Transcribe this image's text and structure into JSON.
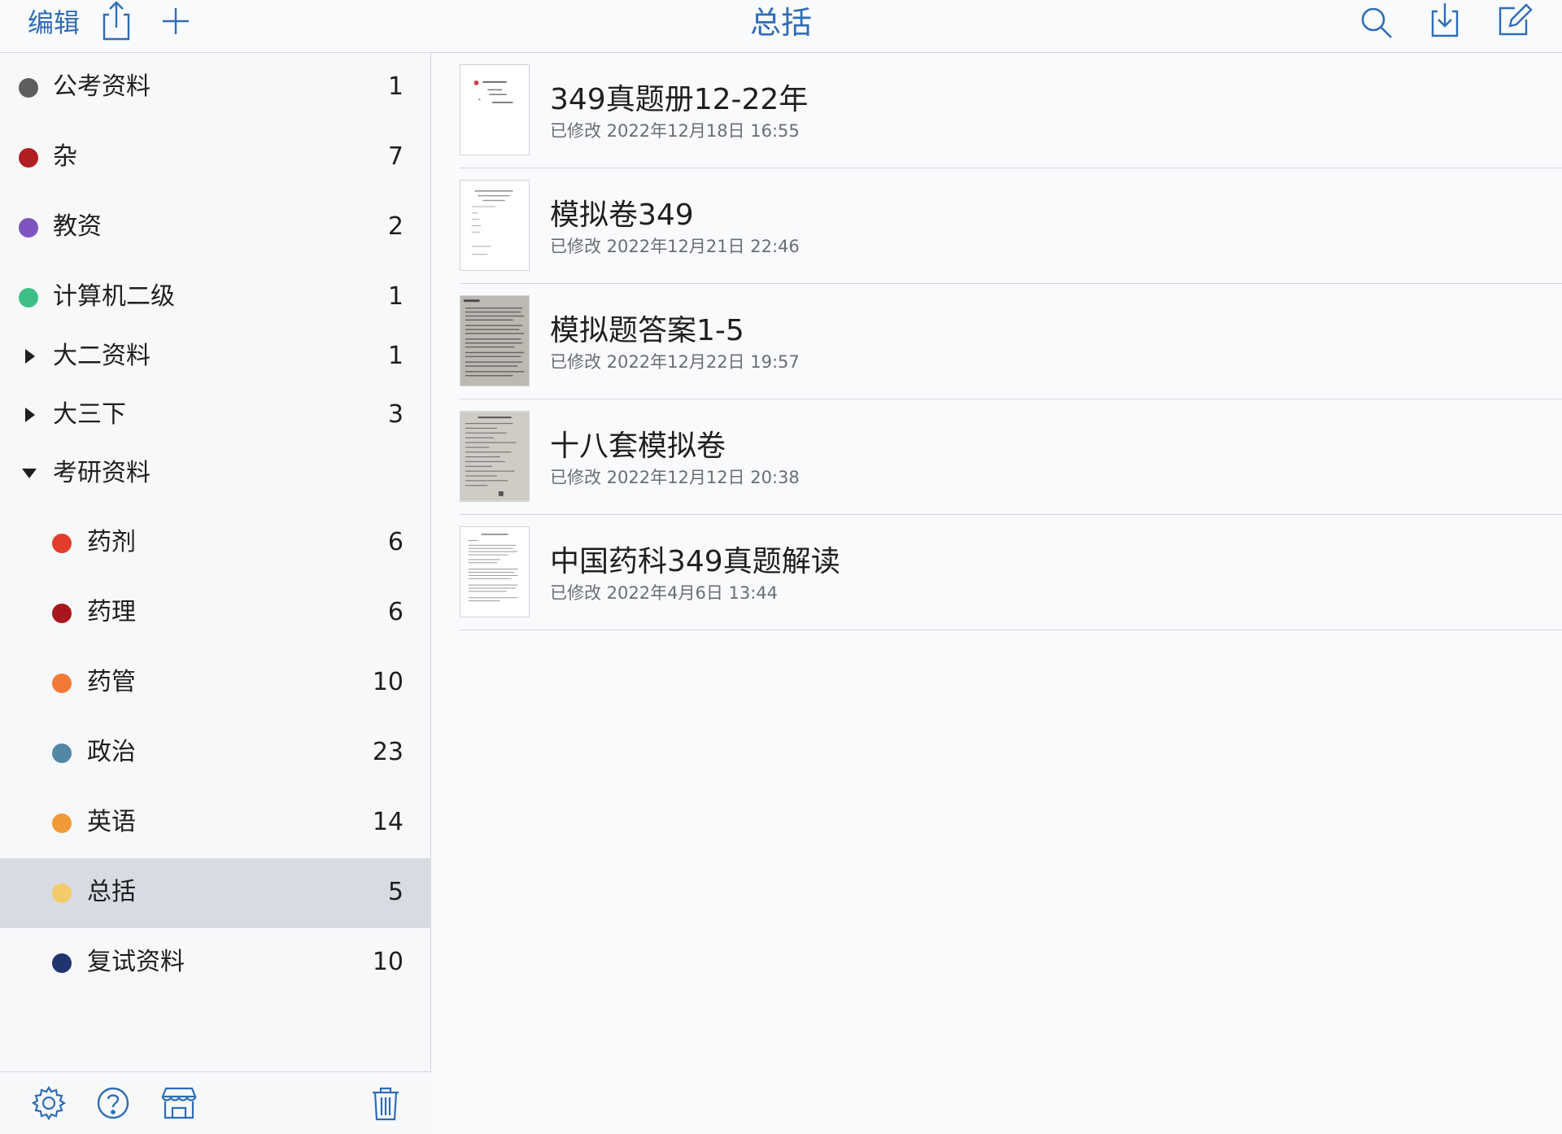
{
  "header": {
    "edit_label": "编辑",
    "title": "总括",
    "icons": [
      "share-icon",
      "plus-icon",
      "search-icon",
      "import-icon",
      "compose-icon"
    ],
    "accent_color": "#2f6db5"
  },
  "sidebar": {
    "items": [
      {
        "label": "公考资料",
        "count": "1",
        "dot_color": "#5d5e60"
      },
      {
        "label": "杂",
        "count": "7",
        "dot_color": "#b01e21"
      },
      {
        "label": "教资",
        "count": "2",
        "dot_color": "#7e55c0"
      },
      {
        "label": "计算机二级",
        "count": "1",
        "dot_color": "#3fbf87"
      },
      {
        "label": "大二资料",
        "count": "1",
        "expander": "collapsed"
      },
      {
        "label": "大三下",
        "count": "3",
        "expander": "collapsed"
      },
      {
        "label": "考研资料",
        "count": "",
        "expander": "expanded"
      },
      {
        "label": "药剂",
        "count": "6",
        "dot_color": "#e33d2c"
      },
      {
        "label": "药理",
        "count": "6",
        "dot_color": "#a8161d"
      },
      {
        "label": "药管",
        "count": "10",
        "dot_color": "#f27a36"
      },
      {
        "label": "政治",
        "count": "23",
        "dot_color": "#5387a6"
      },
      {
        "label": "英语",
        "count": "14",
        "dot_color": "#f09a38"
      },
      {
        "label": "总括",
        "count": "5",
        "dot_color": "#f4cb6a",
        "selected": true
      },
      {
        "label": "复试资料",
        "count": "10",
        "dot_color": "#20356e"
      }
    ],
    "bottom_icons": [
      "gear-icon",
      "help-icon",
      "store-icon",
      "trash-icon"
    ]
  },
  "documents": [
    {
      "title": "349真题册12-22年",
      "modified": "已修改 2022年12月18日 16:55",
      "thumb": "cover"
    },
    {
      "title": "模拟卷349",
      "modified": "已修改 2022年12月21日 22:46",
      "thumb": "sparse"
    },
    {
      "title": "模拟题答案1-5",
      "modified": "已修改 2022年12月22日 19:57",
      "thumb": "scan-dark"
    },
    {
      "title": "十八套模拟卷",
      "modified": "已修改 2022年12月12日 20:38",
      "thumb": "scan-light"
    },
    {
      "title": "中国药科349真题解读",
      "modified": "已修改 2022年4月6日 13:44",
      "thumb": "text"
    }
  ]
}
